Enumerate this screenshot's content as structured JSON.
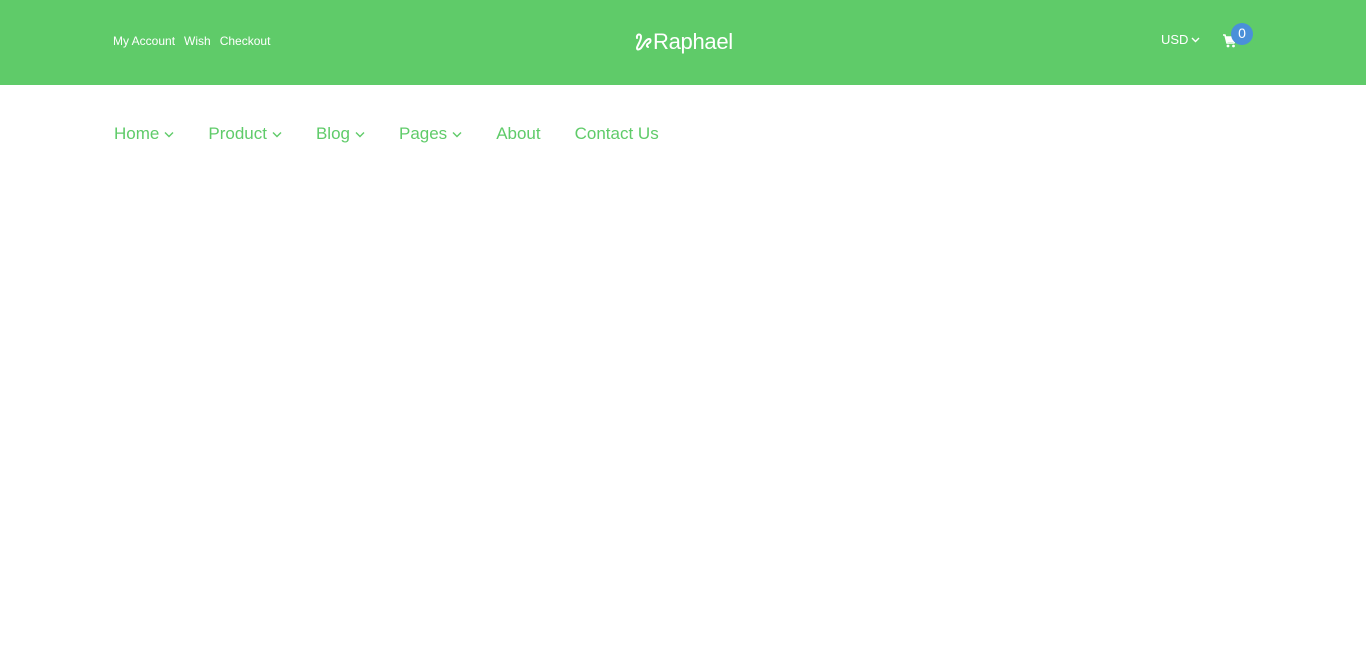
{
  "colors": {
    "brand_green": "#5fcb69",
    "badge_blue": "#4a90d9",
    "text_white": "#ffffff"
  },
  "top_links": [
    {
      "label": "My Account"
    },
    {
      "label": "Wish"
    },
    {
      "label": "Checkout"
    }
  ],
  "logo": {
    "text": "Raphael",
    "icon": "logo-mark-icon"
  },
  "currency": {
    "selected": "USD",
    "icon": "chevron-down-icon"
  },
  "cart": {
    "icon": "shopping-cart-icon",
    "count": "0"
  },
  "nav": {
    "items": [
      {
        "label": "Home",
        "has_dropdown": true
      },
      {
        "label": "Product",
        "has_dropdown": true
      },
      {
        "label": "Blog",
        "has_dropdown": true
      },
      {
        "label": "Pages",
        "has_dropdown": true
      },
      {
        "label": "About",
        "has_dropdown": false
      },
      {
        "label": "Contact Us",
        "has_dropdown": false
      }
    ]
  }
}
